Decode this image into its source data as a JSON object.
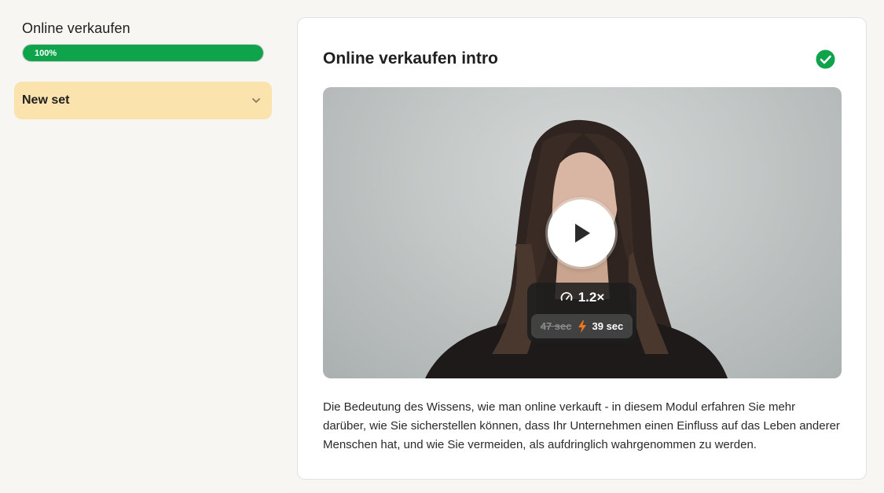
{
  "sidebar": {
    "course_title": "Online verkaufen",
    "progress": {
      "percent": 100,
      "label": "100%"
    },
    "sets": [
      {
        "label": "New set",
        "expanded": false
      }
    ]
  },
  "lesson": {
    "title": "Online verkaufen intro",
    "completed": true,
    "video": {
      "speed_label": "1.2×",
      "original_duration": "47 sec",
      "new_duration": "39 sec"
    },
    "description": "Die Bedeutung des Wissens, wie man online verkauft - in diesem Modul erfahren Sie mehr darüber, wie Sie sicherstellen können, dass Ihr Unternehmen einen Einfluss auf das Leben anderer Menschen hat, und wie Sie vermeiden, als aufdringlich wahrgenommen zu werden."
  },
  "colors": {
    "accent_green": "#0fa44c",
    "set_background": "#fbe3ad",
    "lightning_orange": "#f07a1a"
  },
  "icons": {
    "completed": "check-circle-icon",
    "expand": "chevron-down-icon",
    "play": "play-icon",
    "speed": "speedometer-icon",
    "fast": "lightning-icon"
  }
}
